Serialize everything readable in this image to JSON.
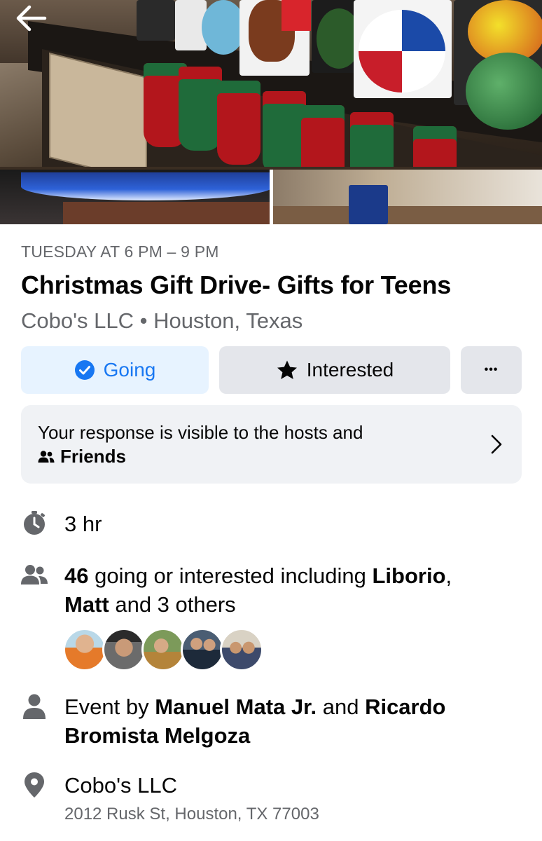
{
  "header": {
    "back_icon": "arrow-left-icon"
  },
  "event": {
    "datetime": "TUESDAY AT 6 PM – 9 PM",
    "title": "Christmas Gift Drive- Gifts for Teens",
    "host_location": "Cobo's LLC • Houston, Texas"
  },
  "actions": {
    "going_label": "Going",
    "going_icon": "check-circle-icon",
    "interested_label": "Interested",
    "interested_icon": "star-icon",
    "more_label": "•••"
  },
  "visibility": {
    "line1": "Your response is visible to the hosts and",
    "audience": "Friends",
    "audience_icon": "friends-icon"
  },
  "details": {
    "duration": "3 hr",
    "attendance": {
      "count": "46",
      "text_1": " going or interested including ",
      "name_1": "Liborio",
      "sep_1": ",",
      "name_2": "Matt",
      "text_2": " and 3 others"
    },
    "hosts": {
      "prefix": "Event by ",
      "host_1": "Manuel Mata Jr.",
      "joiner": " and ",
      "host_2": "Ricardo Bromista Melgoza"
    },
    "location": {
      "name": "Cobo's LLC",
      "address": "2012 Rusk St, Houston, TX 77003"
    }
  },
  "colors": {
    "accent": "#1877f2",
    "going_bg": "#e7f3ff",
    "button_bg": "#e4e6eb",
    "notice_bg": "#f0f2f5",
    "secondary_text": "#65676b",
    "icon_gray": "#65676b"
  }
}
